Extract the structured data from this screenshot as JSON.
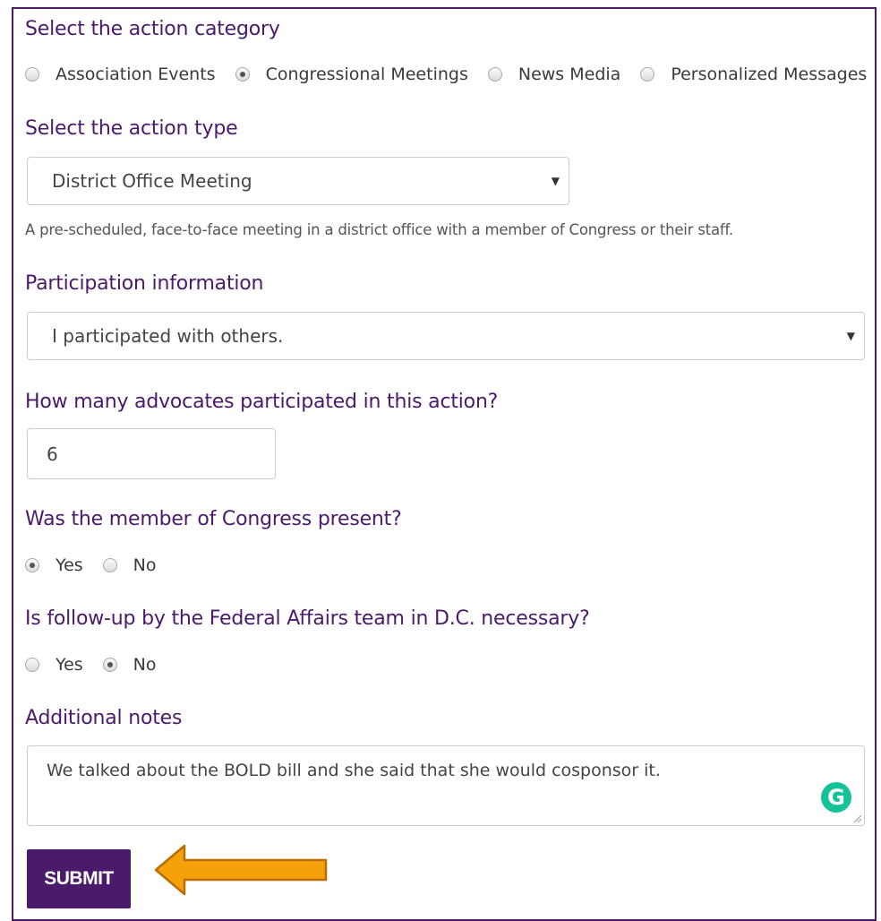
{
  "action_category": {
    "heading": "Select the action category",
    "options": [
      {
        "label": "Association Events",
        "checked": false
      },
      {
        "label": "Congressional Meetings",
        "checked": true
      },
      {
        "label": "News Media",
        "checked": false
      },
      {
        "label": "Personalized Messages",
        "checked": false
      }
    ]
  },
  "action_type": {
    "heading": "Select the action type",
    "selected": "District Office Meeting",
    "help": "A pre-scheduled, face-to-face meeting in a district office with a member of Congress or their staff."
  },
  "participation": {
    "heading": "Participation information",
    "selected": "I participated with others."
  },
  "advocates": {
    "heading": "How many advocates participated in this action?",
    "value": "6"
  },
  "member_present": {
    "heading": "Was the member of Congress present?",
    "options": [
      {
        "label": "Yes",
        "checked": true
      },
      {
        "label": "No",
        "checked": false
      }
    ]
  },
  "follow_up": {
    "heading": "Is follow-up by the Federal Affairs team in D.C. necessary?",
    "options": [
      {
        "label": "Yes",
        "checked": false
      },
      {
        "label": "No",
        "checked": true
      }
    ]
  },
  "notes": {
    "heading": "Additional notes",
    "value": "We talked about the BOLD bill and she said that she would cosponsor it."
  },
  "submit_label": "SUBMIT",
  "icons": {
    "grammarly": "grammarly-icon",
    "caret": "caret-down-icon",
    "arrow": "arrow-left-icon",
    "resize": "resize-handle-icon"
  },
  "colors": {
    "brand_purple": "#4b1a6b",
    "arrow_orange": "#f5a20a",
    "arrow_outline": "#b86e00",
    "grammarly_green": "#15c39a"
  }
}
